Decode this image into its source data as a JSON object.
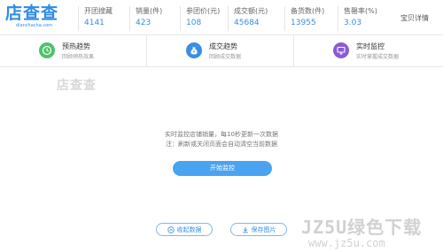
{
  "header": {
    "logo_text": "店查查",
    "logo_sub": "dianchacha.com",
    "stats": [
      {
        "label": "开团搜藏",
        "value": "4141"
      },
      {
        "label": "销量(件)",
        "value": "423"
      },
      {
        "label": "参团价(元)",
        "value": "108"
      },
      {
        "label": "成交额(元)",
        "value": "45684"
      },
      {
        "label": "备货数(件)",
        "value": "13955"
      },
      {
        "label": "售罄率(%)",
        "value": "3.03"
      }
    ],
    "detail_link": "宝贝详情"
  },
  "tabs": [
    {
      "title": "预热趋势",
      "subtitle": "回顾预热效果",
      "icon": "clock-icon",
      "color": "#4cc36a"
    },
    {
      "title": "成交趋势",
      "subtitle": "回顾成交数据",
      "icon": "money-bag-icon",
      "color": "#3a8ee6"
    },
    {
      "title": "实时监控",
      "subtitle": "实时掌握成交数据",
      "icon": "monitor-icon",
      "color": "#8b5bd6"
    }
  ],
  "main": {
    "watermark_logo": "店查查",
    "notice_line1": "实时监控店铺销量，每10秒更新一次数据",
    "notice_line2": "注：刷新或关闭页面会自动清空当前数据",
    "start_button": "开始监控",
    "record_button": "收起数据",
    "save_image_button": "保存图片"
  },
  "site_watermark": {
    "top": "JZ5U绿色下载",
    "bottom": "www.jz5u.com"
  }
}
